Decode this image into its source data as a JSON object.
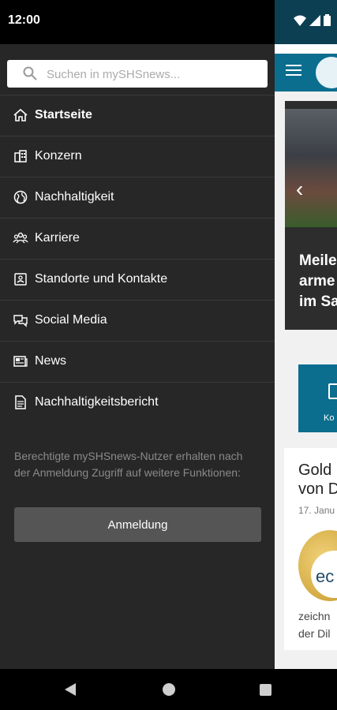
{
  "status_bar": {
    "time": "12:00"
  },
  "search": {
    "placeholder": "Suchen in mySHSnews..."
  },
  "nav": {
    "items": [
      {
        "label": "Startseite",
        "icon": "home-icon",
        "active": true
      },
      {
        "label": "Konzern",
        "icon": "building-icon",
        "active": false
      },
      {
        "label": "Nachhaltigkeit",
        "icon": "globe-icon",
        "active": false
      },
      {
        "label": "Karriere",
        "icon": "people-icon",
        "active": false
      },
      {
        "label": "Standorte und Kontakte",
        "icon": "contact-card-icon",
        "active": false
      },
      {
        "label": "Social Media",
        "icon": "chat-bubbles-icon",
        "active": false
      },
      {
        "label": "News",
        "icon": "newspaper-icon",
        "active": false
      },
      {
        "label": "Nachhaltigkeitsbericht",
        "icon": "document-icon",
        "active": false
      }
    ]
  },
  "notice": {
    "text": "Berechtigte mySHSnews-Nutzer erhalten nach der Anmeldung Zugriff auf weitere Funktionen:"
  },
  "login": {
    "label": "Anmeldung"
  },
  "background_app": {
    "hero_headline": "Meile\narme\nim Sa",
    "tile_label": "Ko",
    "card_title": "Gold\nvon D",
    "card_date": "17. Janu",
    "medal_text": "ec",
    "card_text": "zeichn\nder Dil"
  },
  "colors": {
    "drawer_bg": "#272727",
    "brand_blue": "#0b6e8f",
    "button_bg": "#555555"
  }
}
